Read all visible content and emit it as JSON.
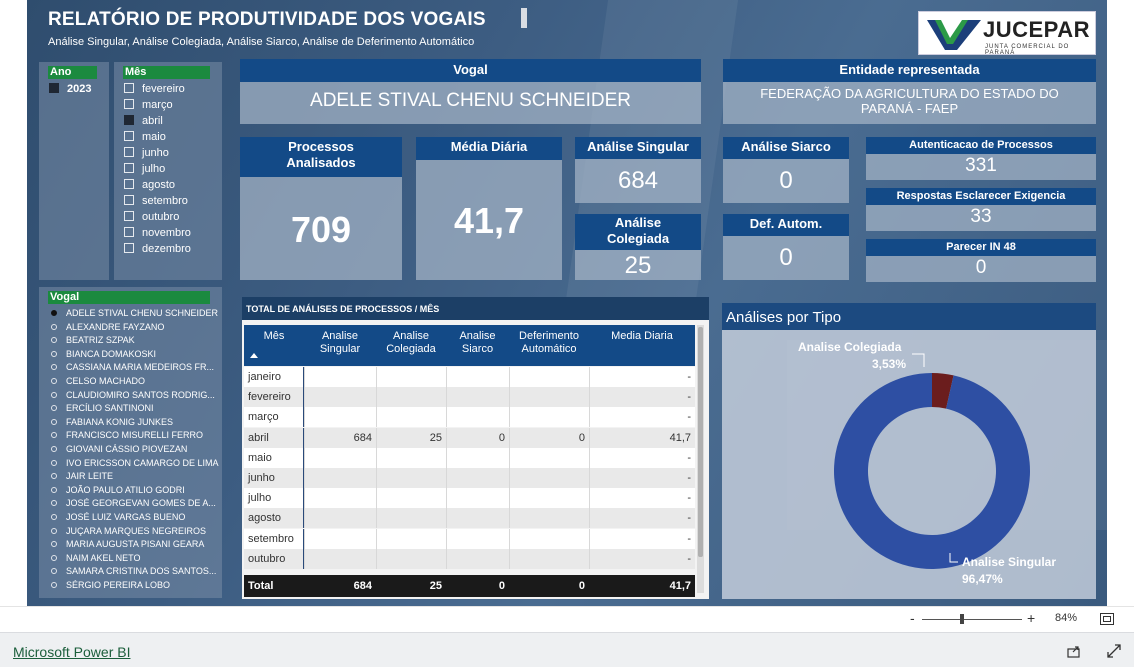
{
  "report": {
    "title": "RELATÓRIO DE PRODUTIVIDADE DOS VOGAIS",
    "subtitle": "Análise Singular, Análise Colegiada, Análise Siarco, Análise de Deferimento Automático",
    "logo": {
      "name": "JUCEPAR",
      "tagline": "JUNTA COMERCIAL DO PARANÁ"
    }
  },
  "slicers": {
    "ano": {
      "label": "Ano",
      "items": [
        {
          "label": "2023",
          "selected": true
        }
      ]
    },
    "mes": {
      "label": "Mês",
      "items": [
        {
          "label": "fevereiro",
          "selected": false
        },
        {
          "label": "março",
          "selected": false
        },
        {
          "label": "abril",
          "selected": true
        },
        {
          "label": "maio",
          "selected": false
        },
        {
          "label": "junho",
          "selected": false
        },
        {
          "label": "julho",
          "selected": false
        },
        {
          "label": "agosto",
          "selected": false
        },
        {
          "label": "setembro",
          "selected": false
        },
        {
          "label": "outubro",
          "selected": false
        },
        {
          "label": "novembro",
          "selected": false
        },
        {
          "label": "dezembro",
          "selected": false
        }
      ]
    },
    "vogal": {
      "label": "Vogal",
      "items": [
        {
          "label": "ADELE STIVAL CHENU SCHNEIDER",
          "selected": true
        },
        {
          "label": "ALEXANDRE FAYZANO",
          "selected": false
        },
        {
          "label": "BEATRIZ SZPAK",
          "selected": false
        },
        {
          "label": "BIANCA DOMAKOSKI",
          "selected": false
        },
        {
          "label": "CASSIANA MARIA MEDEIROS FR...",
          "selected": false
        },
        {
          "label": "CELSO MACHADO",
          "selected": false
        },
        {
          "label": "CLAUDIOMIRO SANTOS RODRIG...",
          "selected": false
        },
        {
          "label": "ERCÍLIO SANTINONI",
          "selected": false
        },
        {
          "label": "FABIANA KONIG JUNKES",
          "selected": false
        },
        {
          "label": "FRANCISCO MISURELLI FERRO",
          "selected": false
        },
        {
          "label": "GIOVANI CÁSSIO PIOVEZAN",
          "selected": false
        },
        {
          "label": "IVO ERICSSON CAMARGO DE LIMA",
          "selected": false
        },
        {
          "label": "JAIR LEITE",
          "selected": false
        },
        {
          "label": "JOÃO PAULO ATILIO GODRI",
          "selected": false
        },
        {
          "label": "JOSÉ GEORGEVAN GOMES DE A...",
          "selected": false
        },
        {
          "label": "JOSÉ LUIZ VARGAS BUENO",
          "selected": false
        },
        {
          "label": "JUÇARA MARQUES NEGREIROS",
          "selected": false
        },
        {
          "label": "MARIA AUGUSTA PISANI GEARA",
          "selected": false
        },
        {
          "label": "NAIM AKEL NETO",
          "selected": false
        },
        {
          "label": "SAMARA CRISTINA DOS SANTOS...",
          "selected": false
        },
        {
          "label": "SÉRGIO PEREIRA LOBO",
          "selected": false
        }
      ]
    }
  },
  "vogal_card": {
    "label": "Vogal",
    "value": "ADELE STIVAL CHENU SCHNEIDER"
  },
  "entidade_card": {
    "label": "Entidade representada",
    "value": "FEDERAÇÃO DA AGRICULTURA DO ESTADO DO PARANÁ - FAEP"
  },
  "kpis": {
    "processos": {
      "label": "Processos Analisados",
      "value": "709"
    },
    "media": {
      "label": "Média Diária",
      "value": "41,7"
    },
    "singular": {
      "label": "Análise Singular",
      "value": "684"
    },
    "colegiada": {
      "label": "Análise Colegiada",
      "value": "25"
    },
    "siarco": {
      "label": "Análise Siarco",
      "value": "0"
    },
    "def_autom": {
      "label": "Def. Autom.",
      "value": "0"
    },
    "autenticacao": {
      "label": "Autenticacao de Processos",
      "value": "331"
    },
    "respostas": {
      "label": "Respostas Esclarecer Exigencia",
      "value": "33"
    },
    "parecer": {
      "label": "Parecer IN 48",
      "value": "0"
    }
  },
  "table": {
    "title": "TOTAL DE ANÁLISES DE PROCESSOS / MÊS",
    "columns": [
      "Mês",
      "Analise Singular",
      "Analise Colegiada",
      "Analise Siarco",
      "Deferimento Automático",
      "Media Diaria"
    ],
    "rows": [
      [
        "janeiro",
        "",
        "",
        "",
        "",
        "-"
      ],
      [
        "fevereiro",
        "",
        "",
        "",
        "",
        "-"
      ],
      [
        "março",
        "",
        "",
        "",
        "",
        "-"
      ],
      [
        "abril",
        "684",
        "25",
        "0",
        "0",
        "41,7"
      ],
      [
        "maio",
        "",
        "",
        "",
        "",
        "-"
      ],
      [
        "junho",
        "",
        "",
        "",
        "",
        "-"
      ],
      [
        "julho",
        "",
        "",
        "",
        "",
        "-"
      ],
      [
        "agosto",
        "",
        "",
        "",
        "",
        "-"
      ],
      [
        "setembro",
        "",
        "",
        "",
        "",
        "-"
      ],
      [
        "outubro",
        "",
        "",
        "",
        "",
        "-"
      ]
    ],
    "total": [
      "Total",
      "684",
      "25",
      "0",
      "0",
      "41,7"
    ]
  },
  "chart_data": {
    "type": "pie",
    "title": "Análises por Tipo",
    "categories": [
      "Analise Colegiada",
      "Analise Singular"
    ],
    "values": [
      3.53,
      96.47
    ],
    "value_labels": [
      "3,53%",
      "96,47%"
    ],
    "colors": [
      "#6b1d1d",
      "#2e4fa3"
    ],
    "donut": true
  },
  "statusbar": {
    "zoom": "84%",
    "zoom_minus": "-",
    "zoom_plus": "+"
  },
  "footer": {
    "link": "Microsoft Power BI"
  }
}
